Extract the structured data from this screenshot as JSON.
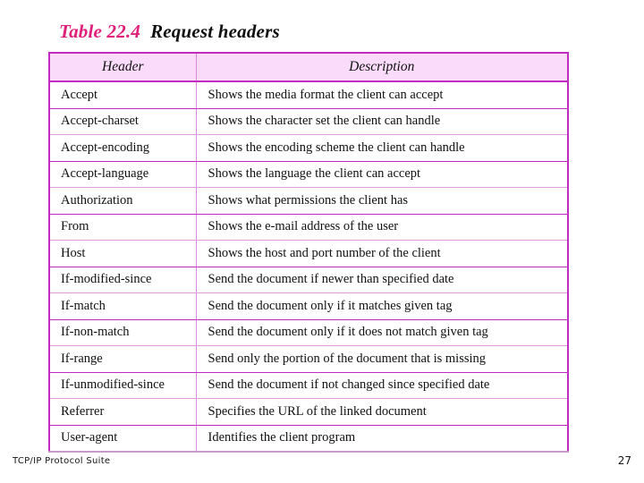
{
  "slide": {
    "title_number": "Table 22.4",
    "title_caption": "Request headers",
    "accent_color": "#E0217A",
    "table_border_color": "#C22BC2",
    "table_header_bg": "#FADCFA"
  },
  "table": {
    "columns": [
      "Header",
      "Description"
    ],
    "rows": [
      {
        "header": "Accept",
        "description": "Shows the media format the client can accept"
      },
      {
        "header": "Accept-charset",
        "description": "Shows the character set the client can handle"
      },
      {
        "header": "Accept-encoding",
        "description": "Shows the encoding scheme the client can handle"
      },
      {
        "header": "Accept-language",
        "description": "Shows the language the client can accept"
      },
      {
        "header": "Authorization",
        "description": "Shows what permissions the client has"
      },
      {
        "header": "From",
        "description": "Shows the e-mail address of the user"
      },
      {
        "header": "Host",
        "description": "Shows the host and port number of the client"
      },
      {
        "header": "If-modified-since",
        "description": "Send the document if newer than specified date"
      },
      {
        "header": "If-match",
        "description": "Send the document only if it matches given tag"
      },
      {
        "header": "If-non-match",
        "description": "Send the document only if it does not match given tag"
      },
      {
        "header": "If-range",
        "description": "Send only the portion of the document that is missing"
      },
      {
        "header": "If-unmodified-since",
        "description": "Send the document if not changed since specified date"
      },
      {
        "header": "Referrer",
        "description": "Specifies the URL of the linked document"
      },
      {
        "header": "User-agent",
        "description": "Identifies the client program"
      }
    ]
  },
  "footer": {
    "source_label": "TCP/IP Protocol Suite",
    "page_number": "27"
  }
}
